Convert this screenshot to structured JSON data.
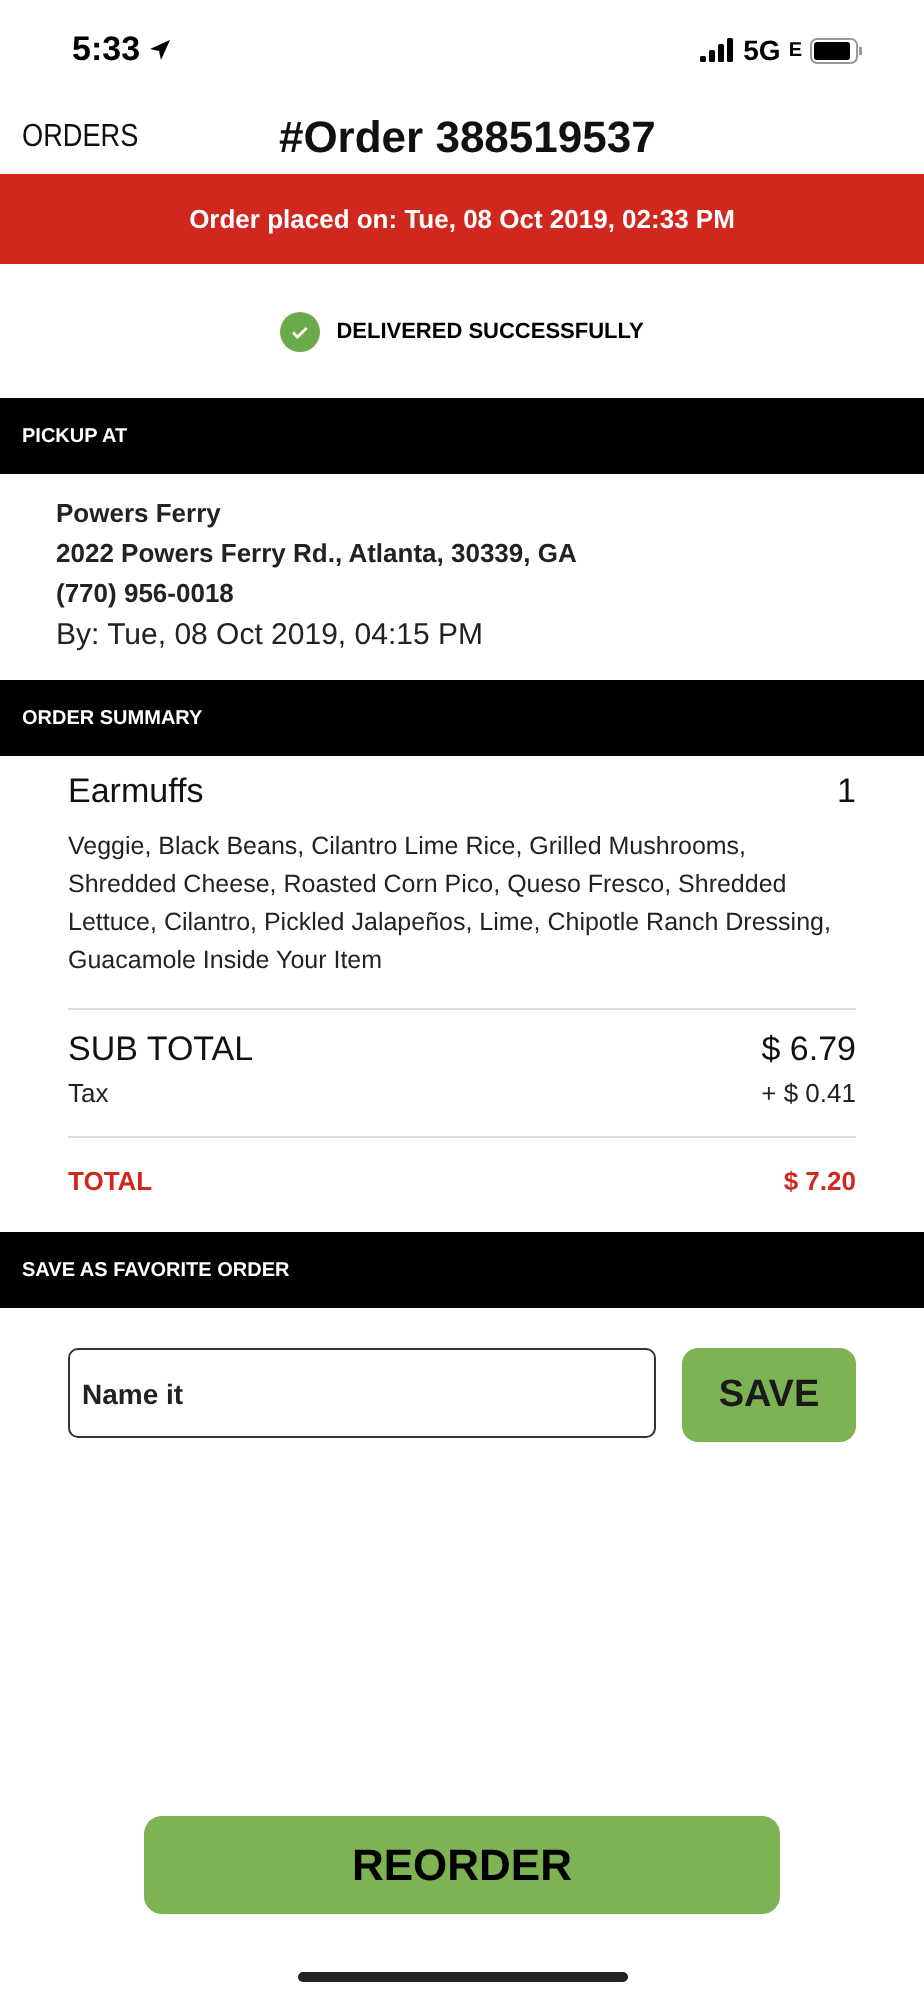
{
  "status_bar": {
    "time": "5:33",
    "network": "5G",
    "network_suffix": "E"
  },
  "nav": {
    "back": "ORDERS",
    "title": "#Order 388519537"
  },
  "placed_banner": "Order placed on: Tue, 08 Oct 2019, 02:33 PM",
  "status": {
    "label": "DELIVERED SUCCESSFULLY"
  },
  "pickup": {
    "heading": "PICKUP AT",
    "store": "Powers Ferry",
    "address": "2022 Powers Ferry Rd., Atlanta, 30339, GA",
    "phone": "(770) 956-0018",
    "by": "By: Tue, 08 Oct 2019, 04:15 PM"
  },
  "summary": {
    "heading": "ORDER SUMMARY",
    "items": [
      {
        "name": "Earmuffs",
        "quantity": "1",
        "details": "Veggie, Black Beans, Cilantro Lime Rice, Grilled Mushrooms, Shredded Cheese, Roasted Corn Pico, Queso Fresco, Shredded Lettuce, Cilantro, Pickled Jalapeños, Lime, Chipotle Ranch Dressing, Guacamole Inside Your Item"
      }
    ],
    "subtotal": {
      "label": "SUB TOTAL",
      "value": "$ 6.79"
    },
    "tax": {
      "label": "Tax",
      "value": "+ $ 0.41"
    },
    "total": {
      "label": "TOTAL",
      "value": "$ 7.20"
    }
  },
  "favorite": {
    "heading": "SAVE AS FAVORITE ORDER",
    "placeholder": "Name it",
    "button": "SAVE"
  },
  "reorder_button": "REORDER"
}
